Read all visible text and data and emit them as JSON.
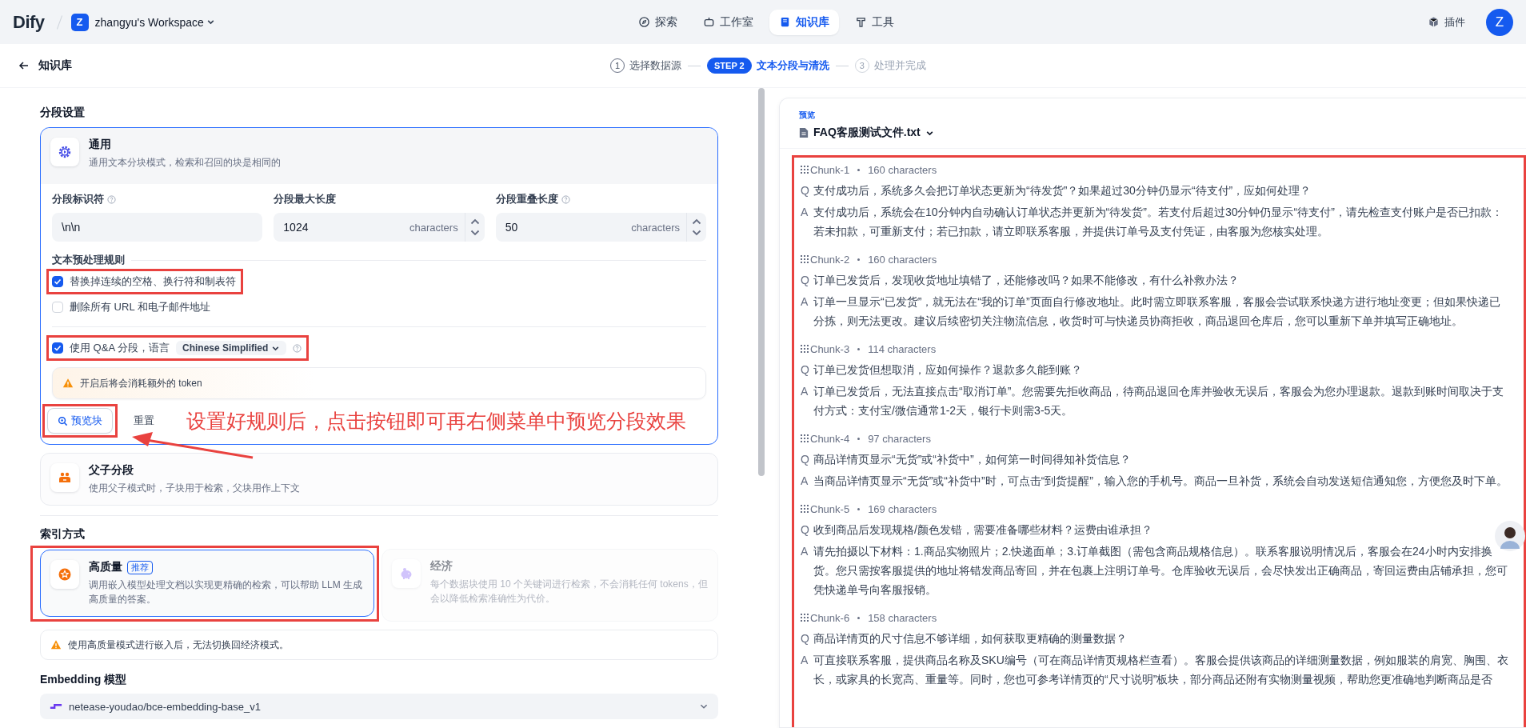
{
  "topbar": {
    "logo": "Dify",
    "workspace_initial": "Z",
    "workspace": "zhangyu's Workspace",
    "nav": [
      {
        "kind": "explore",
        "label": "探索",
        "selected": false
      },
      {
        "kind": "studio",
        "label": "工作室",
        "selected": false
      },
      {
        "kind": "knowledge",
        "label": "知识库",
        "selected": true
      },
      {
        "kind": "tools",
        "label": "工具",
        "selected": false
      }
    ],
    "plugins": "插件",
    "avatar": "Z"
  },
  "subbar": {
    "back": "知识库",
    "steps": [
      {
        "number": "1",
        "label": "选择数据源",
        "selected": false,
        "done": true
      },
      {
        "number": "STEP 2",
        "label": "文本分段与清洗",
        "selected": true,
        "done": false
      },
      {
        "number": "3",
        "label": "处理并完成",
        "selected": false,
        "done": false
      }
    ]
  },
  "segment_settings": {
    "title": "分段设置",
    "modes": [
      {
        "kind": "general",
        "title": "通用",
        "description": "通用文本分块模式，检索和召回的块是相同的",
        "selected": true
      },
      {
        "kind": "parent_child",
        "title": "父子分段",
        "description": "使用父子模式时，子块用于检索，父块用作上下文",
        "selected": false
      }
    ],
    "fields": [
      {
        "kind": "text",
        "label": "分段标识符",
        "help": true,
        "value": "\\n\\n"
      },
      {
        "kind": "number",
        "label": "分段最大长度",
        "help": false,
        "value": "1024",
        "unit": "characters"
      },
      {
        "kind": "number",
        "label": "分段重叠长度",
        "help": true,
        "value": "50",
        "unit": "characters"
      }
    ],
    "rules_title": "文本预处理规则",
    "rules": [
      {
        "label": "替换掉连续的空格、换行符和制表符",
        "checked": true,
        "annotated": true
      },
      {
        "label": "删除所有 URL 和电子邮件地址",
        "checked": false,
        "annotated": false
      }
    ],
    "qa": {
      "checked": true,
      "label": "使用 Q&A 分段，语言",
      "language": "Chinese Simplified",
      "annotated": true
    },
    "warning": "开启后将会消耗额外的 token",
    "preview_button": {
      "label": "预览块",
      "annotated": true
    },
    "reset_button": "重置"
  },
  "annotation": {
    "text": "设置好规则后，点击按钮即可再右侧菜单中预览分段效果"
  },
  "index": {
    "title": "索引方式",
    "options": [
      {
        "kind": "high_quality",
        "title": "高质量",
        "badge": "推荐",
        "description": "调用嵌入模型处理文档以实现更精确的检索，可以帮助 LLM 生成高质量的答案。",
        "selected": true,
        "annotated": true
      },
      {
        "kind": "economy",
        "title": "经济",
        "description": "每个数据块使用 10 个关键词进行检索，不会消耗任何 tokens，但会以降低检索准确性为代价。",
        "selected": false,
        "annotated": false
      }
    ],
    "warning": "使用高质量模式进行嵌入后，无法切换回经济模式。"
  },
  "embedding": {
    "title": "Embedding 模型",
    "model": "netease-youdao/bce-embedding-base_v1"
  },
  "preview": {
    "label": "预览",
    "file": "FAQ客服测试文件.txt",
    "annotated": true,
    "chunks": [
      {
        "name": "Chunk-1",
        "count": "160 characters",
        "q_mark": "Q",
        "question": "支付成功后，系统多久会把订单状态更新为“待发货”？如果超过30分钟仍显示“待支付”，应如何处理？",
        "a_mark": "A",
        "answer": "支付成功后，系统会在10分钟内自动确认订单状态并更新为“待发货”。若支付后超过30分钟仍显示“待支付”，请先检查支付账户是否已扣款：若未扣款，可重新支付；若已扣款，请立即联系客服，并提供订单号及支付凭证，由客服为您核实处理。"
      },
      {
        "name": "Chunk-2",
        "count": "160 characters",
        "q_mark": "Q",
        "question": "订单已发货后，发现收货地址填错了，还能修改吗？如果不能修改，有什么补救办法？",
        "a_mark": "A",
        "answer": "订单一旦显示“已发货”，就无法在“我的订单”页面自行修改地址。此时需立即联系客服，客服会尝试联系快递方进行地址变更；但如果快递已分拣，则无法更改。建议后续密切关注物流信息，收货时可与快递员协商拒收，商品退回仓库后，您可以重新下单并填写正确地址。"
      },
      {
        "name": "Chunk-3",
        "count": "114 characters",
        "q_mark": "Q",
        "question": "订单已发货但想取消，应如何操作？退款多久能到账？",
        "a_mark": "A",
        "answer": "订单已发货后，无法直接点击“取消订单”。您需要先拒收商品，待商品退回仓库并验收无误后，客服会为您办理退款。退款到账时间取决于支付方式：支付宝/微信通常1-2天，银行卡则需3-5天。"
      },
      {
        "name": "Chunk-4",
        "count": "97 characters",
        "q_mark": "Q",
        "question": "商品详情页显示“无货”或“补货中”，如何第一时间得知补货信息？",
        "a_mark": "A",
        "answer": "当商品详情页显示“无货”或“补货中”时，可点击“到货提醒”，输入您的手机号。商品一旦补货，系统会自动发送短信通知您，方便您及时下单。"
      },
      {
        "name": "Chunk-5",
        "count": "169 characters",
        "q_mark": "Q",
        "question": "收到商品后发现规格/颜色发错，需要准备哪些材料？运费由谁承担？",
        "a_mark": "A",
        "answer": "请先拍摄以下材料：1.商品实物照片；2.快递面单；3.订单截图（需包含商品规格信息）。联系客服说明情况后，客服会在24小时内安排换货。您只需按客服提供的地址将错发商品寄回，并在包裹上注明订单号。仓库验收无误后，会尽快发出正确商品，寄回运费由店铺承担，您可凭快递单号向客服报销。"
      },
      {
        "name": "Chunk-6",
        "count": "158 characters",
        "q_mark": "Q",
        "question": "商品详情页的尺寸信息不够详细，如何获取更精确的测量数据？",
        "a_mark": "A",
        "answer": "可直接联系客服，提供商品名称及SKU编号（可在商品详情页规格栏查看）。客服会提供该商品的详细测量数据，例如服装的肩宽、胸围、衣长，或家具的长宽高、重量等。同时，您也可参考详情页的“尺寸说明”板块，部分商品还附有实物测量视频，帮助您更准确地判断商品是否"
      }
    ]
  }
}
